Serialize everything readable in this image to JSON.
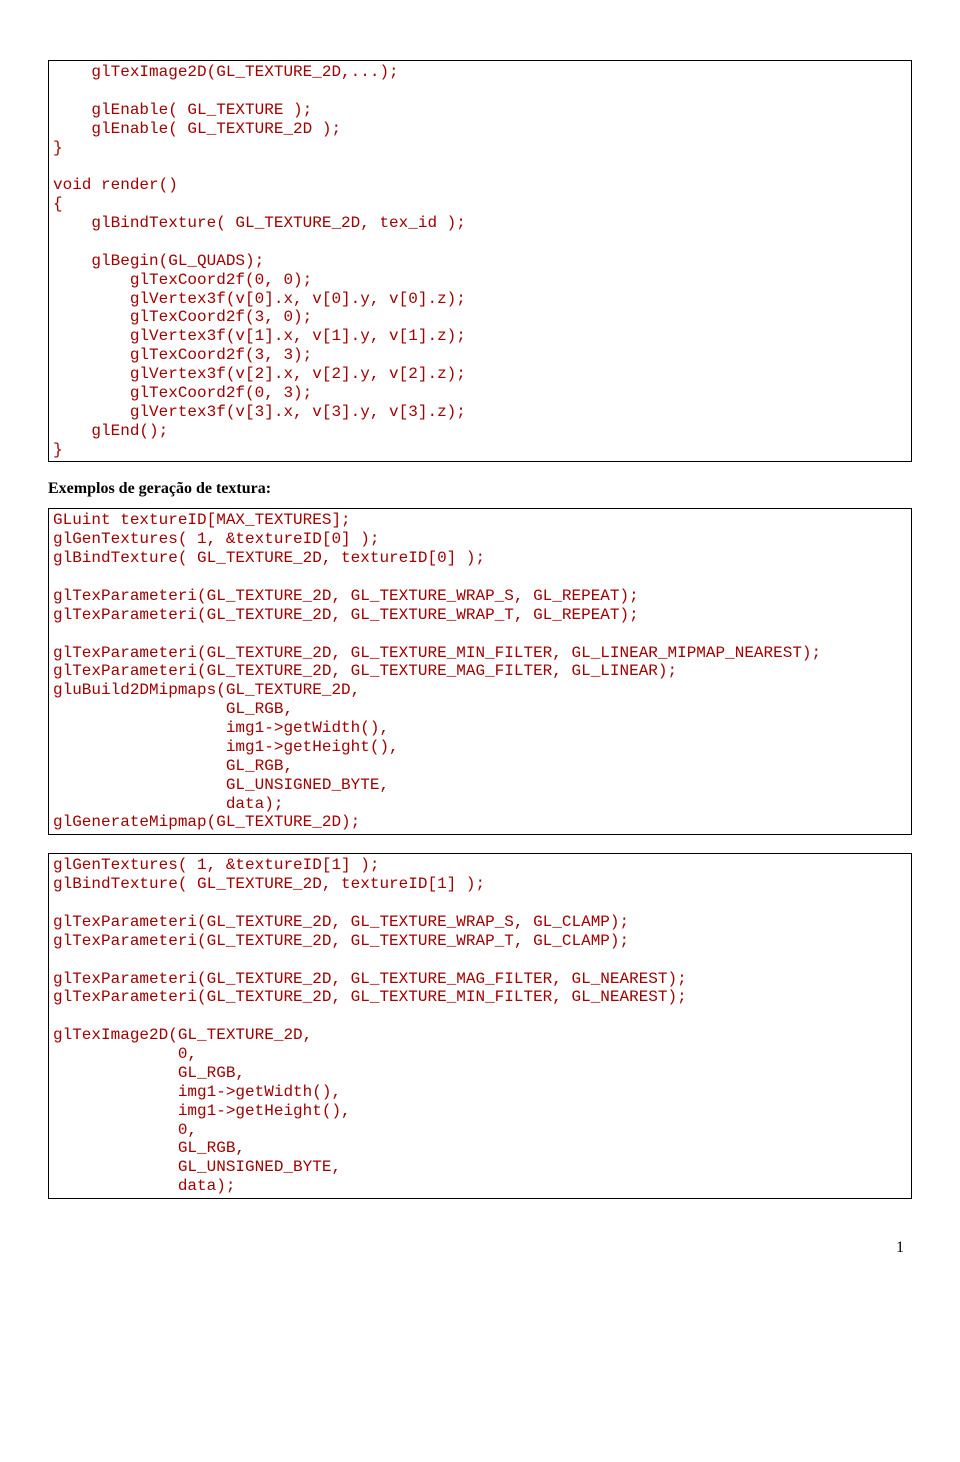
{
  "code1": "    glTexImage2D(GL_TEXTURE_2D,...);\n\n    glEnable( GL_TEXTURE );\n    glEnable( GL_TEXTURE_2D );\n}\n\nvoid render()\n{\n    glBindTexture( GL_TEXTURE_2D, tex_id );\n\n    glBegin(GL_QUADS);\n        glTexCoord2f(0, 0);\n        glVertex3f(v[0].x, v[0].y, v[0].z);\n        glTexCoord2f(3, 0);\n        glVertex3f(v[1].x, v[1].y, v[1].z);\n        glTexCoord2f(3, 3);\n        glVertex3f(v[2].x, v[2].y, v[2].z);\n        glTexCoord2f(0, 3);\n        glVertex3f(v[3].x, v[3].y, v[3].z);\n    glEnd();\n}",
  "heading": "Exemplos de geração de textura:",
  "code2": "GLuint textureID[MAX_TEXTURES];\nglGenTextures( 1, &textureID[0] );\nglBindTexture( GL_TEXTURE_2D, textureID[0] );\n\nglTexParameteri(GL_TEXTURE_2D, GL_TEXTURE_WRAP_S, GL_REPEAT);\nglTexParameteri(GL_TEXTURE_2D, GL_TEXTURE_WRAP_T, GL_REPEAT);\n\nglTexParameteri(GL_TEXTURE_2D, GL_TEXTURE_MIN_FILTER, GL_LINEAR_MIPMAP_NEAREST);\nglTexParameteri(GL_TEXTURE_2D, GL_TEXTURE_MAG_FILTER, GL_LINEAR);\ngluBuild2DMipmaps(GL_TEXTURE_2D,\n                  GL_RGB,\n                  img1->getWidth(),\n                  img1->getHeight(),\n                  GL_RGB,\n                  GL_UNSIGNED_BYTE,\n                  data);\nglGenerateMipmap(GL_TEXTURE_2D);",
  "code3": "glGenTextures( 1, &textureID[1] );\nglBindTexture( GL_TEXTURE_2D, textureID[1] );\n\nglTexParameteri(GL_TEXTURE_2D, GL_TEXTURE_WRAP_S, GL_CLAMP);\nglTexParameteri(GL_TEXTURE_2D, GL_TEXTURE_WRAP_T, GL_CLAMP);\n\nglTexParameteri(GL_TEXTURE_2D, GL_TEXTURE_MAG_FILTER, GL_NEAREST);\nglTexParameteri(GL_TEXTURE_2D, GL_TEXTURE_MIN_FILTER, GL_NEAREST);\n\nglTexImage2D(GL_TEXTURE_2D,\n             0,\n             GL_RGB,\n             img1->getWidth(),\n             img1->getHeight(),\n             0,\n             GL_RGB,\n             GL_UNSIGNED_BYTE,\n             data);",
  "pageNumber": "1"
}
